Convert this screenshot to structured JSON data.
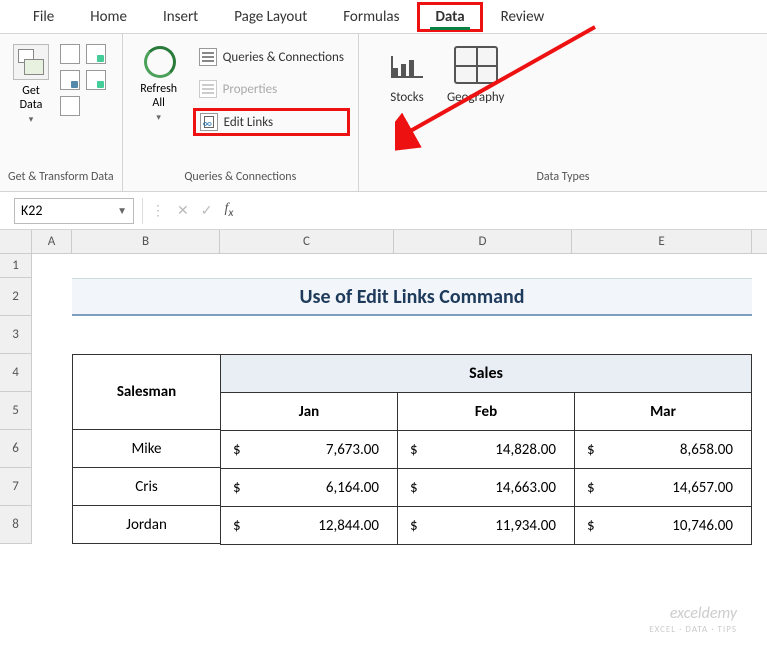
{
  "tabs": {
    "file": "File",
    "home": "Home",
    "insert": "Insert",
    "page_layout": "Page Layout",
    "formulas": "Formulas",
    "data": "Data",
    "review": "Review"
  },
  "ribbon": {
    "group1_label": "Get & Transform Data",
    "get_data": "Get\nData",
    "group2_label": "Queries & Connections",
    "refresh_all": "Refresh\nAll",
    "queries_connections": "Queries & Connections",
    "properties": "Properties",
    "edit_links": "Edit Links",
    "group3_label": "Data Types",
    "stocks": "Stocks",
    "geography": "Geography"
  },
  "namebox": "K22",
  "sheet": {
    "col_headers": [
      "A",
      "B",
      "C",
      "D",
      "E"
    ],
    "row_headers": [
      "1",
      "2",
      "3",
      "4",
      "5",
      "6",
      "7",
      "8"
    ],
    "title": "Use of Edit Links Command",
    "sales_header": "Sales",
    "salesman_header": "Salesman",
    "months": [
      "Jan",
      "Feb",
      "Mar"
    ],
    "rows": [
      {
        "name": "Mike",
        "jan": "7,673.00",
        "feb": "14,828.00",
        "mar": "8,658.00"
      },
      {
        "name": "Cris",
        "jan": "6,164.00",
        "feb": "14,663.00",
        "mar": "14,657.00"
      },
      {
        "name": "Jordan",
        "jan": "12,844.00",
        "feb": "11,934.00",
        "mar": "10,746.00"
      }
    ],
    "currency": "$"
  },
  "watermark": {
    "main": "exceldemy",
    "sub": "EXCEL · DATA · TIPS"
  }
}
